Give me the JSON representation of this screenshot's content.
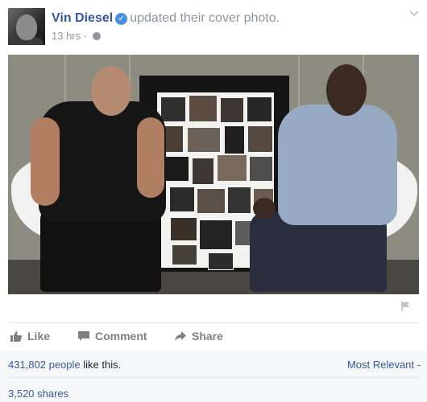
{
  "post": {
    "author": "Vin Diesel",
    "action": "updated their cover photo.",
    "time": "13 hrs",
    "separator": "·"
  },
  "actions": {
    "like": "Like",
    "comment": "Comment",
    "share": "Share"
  },
  "summary": {
    "likes_link": "431,802 people",
    "likes_suffix": " like this.",
    "sort": "Most Relevant",
    "sort_arrow": "-",
    "shares": "3,520 shares"
  },
  "icons": {
    "verified": "verified-badge-icon",
    "globe": "globe-icon",
    "menu": "chevron-down-icon",
    "flag": "flag-icon",
    "like": "thumbs-up-icon",
    "comment": "comment-bubble-icon",
    "share": "share-arrow-icon"
  },
  "colors": {
    "link": "#365899",
    "muted": "#90949c",
    "verified": "#4a90e2",
    "action_gray": "#7f7f7f",
    "summary_bg": "#f6f7f9"
  }
}
